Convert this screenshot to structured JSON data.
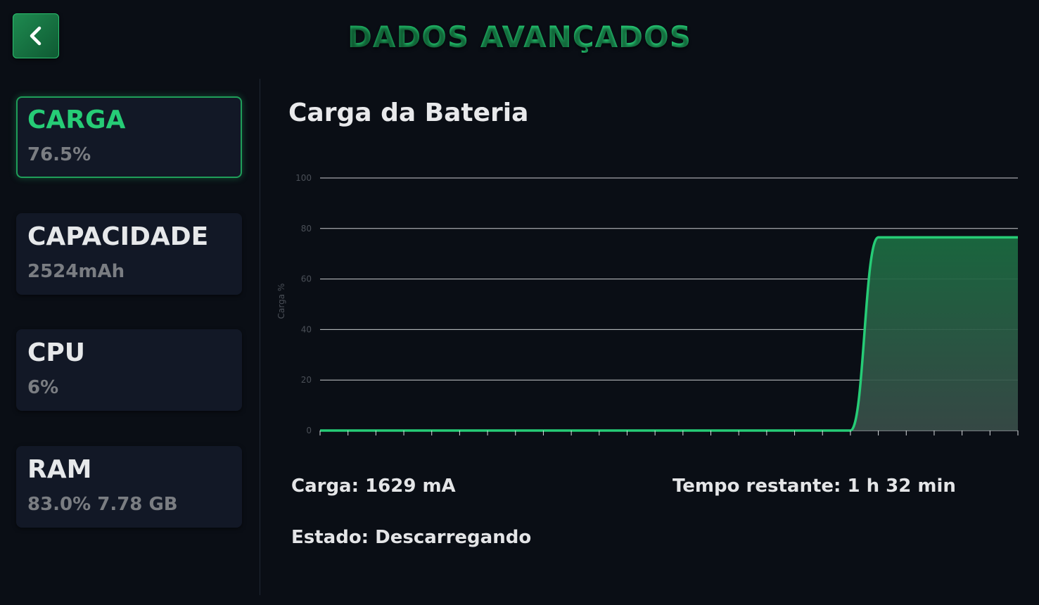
{
  "header": {
    "title": "DADOS AVANÇADOS",
    "back_icon": "chevron-left-icon"
  },
  "sidebar": {
    "cards": [
      {
        "title": "CARGA",
        "value": "76.5%",
        "active": true
      },
      {
        "title": "CAPACIDADE",
        "value": "2524mAh",
        "active": false
      },
      {
        "title": "CPU",
        "value": "6%",
        "active": false
      },
      {
        "title": "RAM",
        "value": "83.0% 7.78 GB",
        "active": false
      }
    ]
  },
  "main": {
    "chart_title": "Carga da Bateria",
    "info": {
      "carga": "Carga: 1629 mA",
      "tempo": "Tempo restante: 1 h 32 min",
      "estado": "Estado: Descarregando"
    }
  },
  "colors": {
    "accent": "#26cc76",
    "background": "#0a0e15",
    "card": "#121826",
    "muted_text": "#7a7d82"
  },
  "chart_data": {
    "type": "area",
    "ylabel": "Carga %",
    "ylim": [
      0,
      100
    ],
    "yticks": [
      "0",
      "20",
      "40",
      "60",
      "80",
      "100"
    ],
    "x": [
      0,
      1,
      2,
      3,
      4,
      5,
      6,
      7,
      8,
      9,
      10,
      11,
      12,
      13,
      14,
      15,
      16,
      17,
      18,
      19,
      20,
      21,
      22,
      23,
      24,
      25
    ],
    "values": [
      0,
      0,
      0,
      0,
      0,
      0,
      0,
      0,
      0,
      0,
      0,
      0,
      0,
      0,
      0,
      0,
      0,
      0,
      0,
      0,
      76.5,
      76.5,
      76.5,
      76.5,
      76.5,
      76.5
    ],
    "color": "#26cc76"
  }
}
